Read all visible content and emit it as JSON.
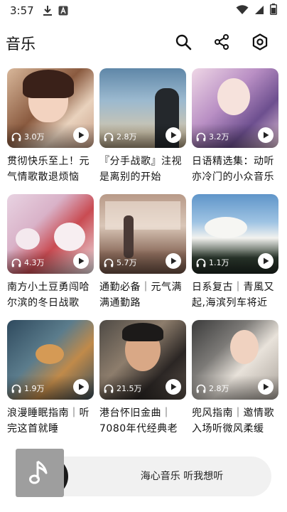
{
  "status_bar": {
    "time": "3:57",
    "icons": [
      "download-icon",
      "notification-a-icon",
      "wifi-icon",
      "signal-icon",
      "battery-icon"
    ]
  },
  "app_bar": {
    "title": "音乐",
    "actions": [
      "search-icon",
      "share-icon",
      "settings-icon"
    ]
  },
  "playlists": [
    {
      "title": "贯彻快乐至上！元气情歌散退烦恼",
      "plays": "3.0万"
    },
    {
      "title": "『分手战歌』注视是离别的开始",
      "plays": "2.8万"
    },
    {
      "title": "日语精选集：动听亦冷门的小众音乐",
      "plays": "3.2万"
    },
    {
      "title": "南方小土豆勇闯哈尔滨的冬日战歌",
      "plays": "4.3万"
    },
    {
      "title": "通勤必备｜元气满满通勤路",
      "plays": "5.7万"
    },
    {
      "title": "日系复古｜青風又起,海滨列车将近",
      "plays": "1.1万"
    },
    {
      "title": "浪漫睡眠指南｜听完这首就睡",
      "plays": "1.9万"
    },
    {
      "title": "港台怀旧金曲｜7080年代经典老歌",
      "plays": "21.5万"
    },
    {
      "title": "兜风指南｜邀情歌入场听微风柔缓",
      "plays": "2.8万"
    }
  ],
  "player": {
    "text": "海心音乐 听我想听",
    "art_icon": "music-note-icon"
  },
  "colors": {
    "background": "#ffffff",
    "player_bg": "#f1f1f1",
    "art_placeholder": "#9e9e9e"
  }
}
